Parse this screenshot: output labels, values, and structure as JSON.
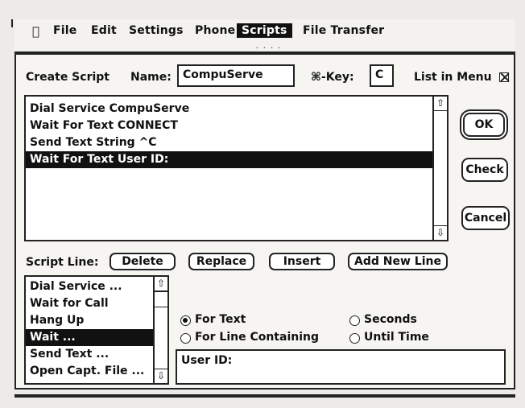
{
  "menubar": {
    "apple": "",
    "items": [
      "File",
      "Edit",
      "Settings",
      "Phone",
      "Scripts",
      "File Transfer"
    ],
    "active_index": 4
  },
  "dialog": {
    "create_script_label": "Create Script",
    "name_label": "Name:",
    "name_value": "CompuServe",
    "key_label": "⌘-Key:",
    "key_value": "C",
    "list_in_menu_label": "List in Menu",
    "list_in_menu_checked": true,
    "script_lines": [
      "Dial Service CompuServe",
      "Wait For Text CONNECT",
      "Send Text String ^C",
      "Wait For Text User ID:"
    ],
    "script_selected_index": 3,
    "ok_label": "OK",
    "check_label": "Check",
    "cancel_label": "Cancel",
    "script_line_label": "Script Line:",
    "delete_label": "Delete",
    "replace_label": "Replace",
    "insert_label": "Insert",
    "add_new_line_label": "Add New Line",
    "commands": [
      "Dial Service ...",
      "Wait for Call",
      "Hang Up",
      "Wait ...",
      "Send Text ...",
      "Open Capt. File ..."
    ],
    "command_selected_index": 3,
    "radio_for_text": "For Text",
    "radio_for_line": "For Line Containing",
    "radio_seconds": "Seconds",
    "radio_until_time": "Until Time",
    "radio_selected": "For Text",
    "text_value": "User ID:"
  }
}
